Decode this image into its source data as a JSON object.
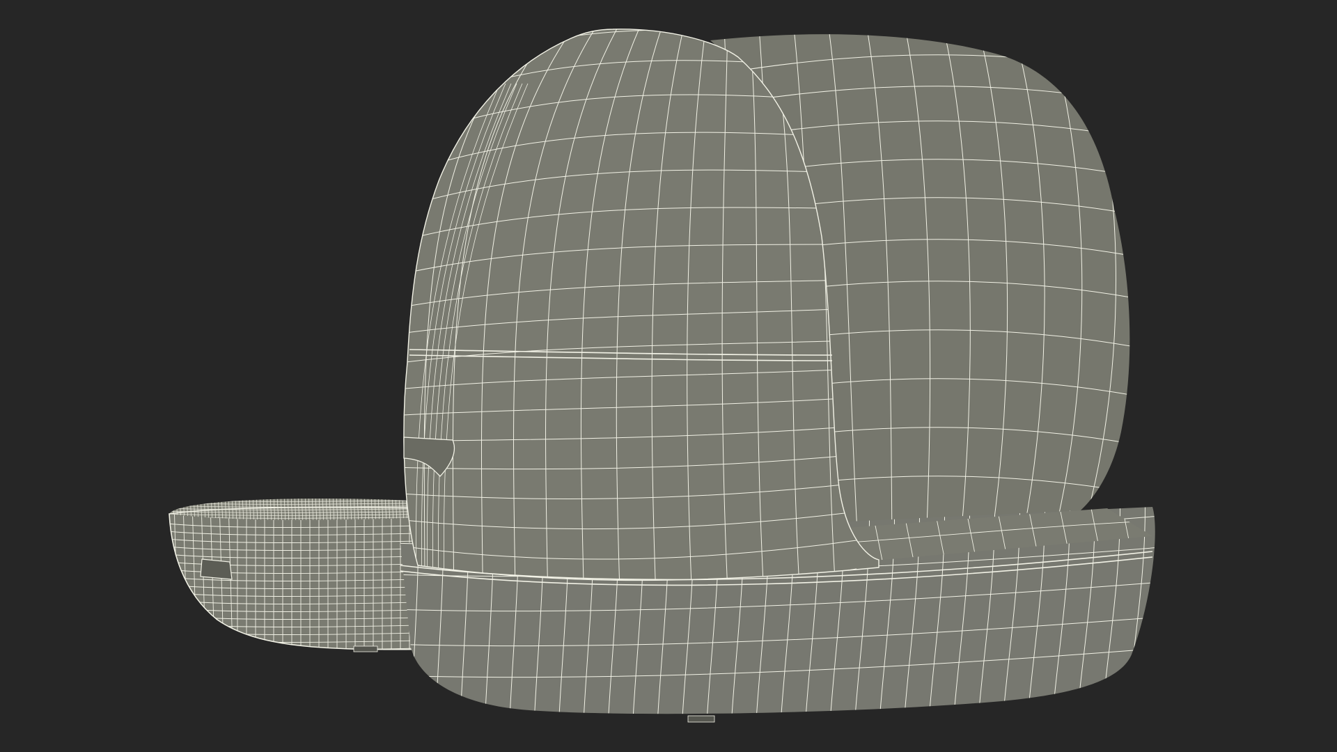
{
  "scene": {
    "subject": "wireframe-3d-model",
    "colors": {
      "background": "#262626",
      "surface_front": "#797a70",
      "surface_dark": "#6c6d64",
      "surface_rear": "#76776d",
      "surface_side": "#73746a",
      "base": "#777870",
      "tray_top": "#808176",
      "tray_side": "#7a7b71",
      "wire": "#f2f2e6"
    }
  }
}
